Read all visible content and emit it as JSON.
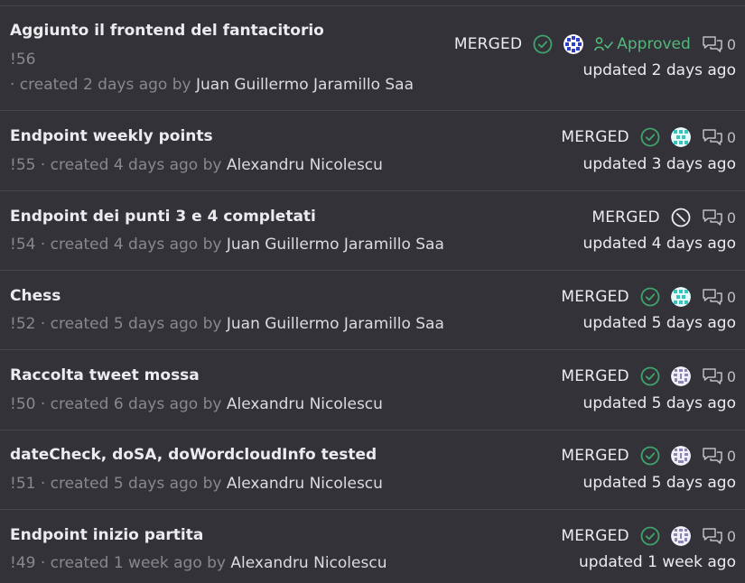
{
  "merge_requests": [
    {
      "title": "Aggiunto il frontend del fantacitorio",
      "id": "!56",
      "created_text": "· created 2 days ago by",
      "author": "Juan Guillermo Jaramillo Saa",
      "status": "MERGED",
      "pipeline": "passed",
      "approved_label": "Approved",
      "comments": "0",
      "updated": "updated 2 days ago"
    },
    {
      "title": "Endpoint weekly points",
      "id": "!55",
      "created_text": "· created 4 days ago by",
      "author": "Alexandru Nicolescu",
      "status": "MERGED",
      "pipeline": "passed",
      "comments": "0",
      "updated": "updated 3 days ago"
    },
    {
      "title": "Endpoint dei punti 3 e 4 completati",
      "id": "!54",
      "created_text": "· created 4 days ago by",
      "author": "Juan Guillermo Jaramillo Saa",
      "status": "MERGED",
      "pipeline": "canceled",
      "comments": "0",
      "updated": "updated 4 days ago"
    },
    {
      "title": "Chess",
      "id": "!52",
      "created_text": "· created 5 days ago by",
      "author": "Juan Guillermo Jaramillo Saa",
      "status": "MERGED",
      "pipeline": "passed",
      "comments": "0",
      "updated": "updated 5 days ago"
    },
    {
      "title": "Raccolta tweet mossa",
      "id": "!50",
      "created_text": "· created 6 days ago by",
      "author": "Alexandru Nicolescu",
      "status": "MERGED",
      "pipeline": "passed",
      "comments": "0",
      "updated": "updated 5 days ago"
    },
    {
      "title": "dateCheck, doSA, doWordcloudInfo tested",
      "id": "!51",
      "created_text": "· created 5 days ago by",
      "author": "Alexandru Nicolescu",
      "status": "MERGED",
      "pipeline": "passed",
      "comments": "0",
      "updated": "updated 5 days ago"
    },
    {
      "title": "Endpoint inizio partita",
      "id": "!49",
      "created_text": "· created 1 week ago by",
      "author": "Alexandru Nicolescu",
      "status": "MERGED",
      "pipeline": "passed",
      "comments": "0",
      "updated": "updated 1 week ago"
    }
  ],
  "colors": {
    "background": "#333238",
    "pipeline_passed": "#3fa36b",
    "approved": "#52b87a",
    "avatar_blue": "#2f3fc4",
    "avatar_teal": "#33c7c0",
    "avatar_purple": "#8a86b8"
  }
}
